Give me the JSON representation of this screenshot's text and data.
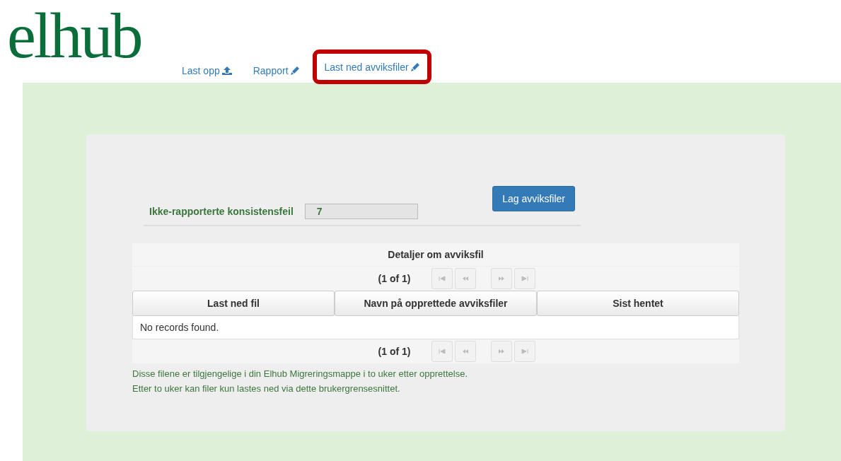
{
  "logo": {
    "text": "elhub"
  },
  "tabs": [
    {
      "label": "Last opp",
      "kind": "upload",
      "selected": false
    },
    {
      "label": "Rapport",
      "kind": "edit",
      "selected": false
    },
    {
      "label": "Last ned avviksfiler",
      "kind": "edit",
      "selected": true
    }
  ],
  "form": {
    "label": "Ikke-rapporterte konsistensfeil",
    "value": "7",
    "button": "Lag avviksfiler"
  },
  "table": {
    "title": "Detaljer om avviksfil",
    "pager_top": {
      "text": "(1 of 1)",
      "disabled": true
    },
    "columns": [
      "Last ned fil",
      "Navn på opprettede avviksfiler",
      "Sist hentet"
    ],
    "empty_message": "No records found.",
    "pager_bottom": {
      "text": "(1 of 1)",
      "disabled": true
    }
  },
  "notes": [
    "Disse filene er tilgjengelige i din Elhub Migreringsmappe i to uker etter opprettelse.",
    "Etter to uker kan filer kun lastes ned via dette brukergrensesnittet."
  ]
}
